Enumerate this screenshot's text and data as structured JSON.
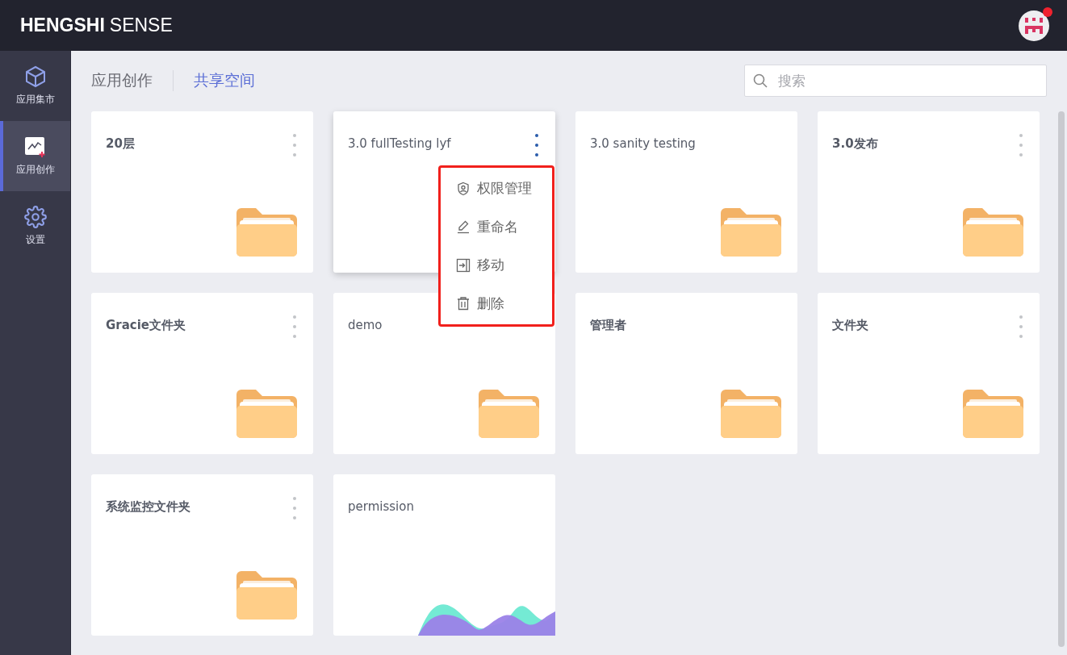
{
  "header": {
    "logo_bold": "HENGSHI",
    "logo_rest": "SENSE",
    "notification": true
  },
  "sidebar": {
    "items": [
      {
        "label": "应用集市",
        "selected": false
      },
      {
        "label": "应用创作",
        "selected": true
      },
      {
        "label": "设置",
        "selected": false
      }
    ]
  },
  "tabs": [
    {
      "label": "应用创作",
      "selected": true
    },
    {
      "label": "共享空间",
      "selected": false
    }
  ],
  "search": {
    "placeholder": "搜索"
  },
  "cards": [
    {
      "title": "20层",
      "kind": "folder",
      "bold": true,
      "menu_button": true,
      "menu_open": false
    },
    {
      "title": "3.0 fullTesting lyf",
      "kind": "folder_hidden",
      "bold": false,
      "menu_button": true,
      "menu_open": true
    },
    {
      "title": "3.0 sanity testing",
      "kind": "folder",
      "bold": false,
      "menu_button": false,
      "menu_open": false
    },
    {
      "title": "3.0发布",
      "kind": "folder",
      "bold": true,
      "menu_button": true,
      "menu_open": false
    },
    {
      "title": "Gracie文件夹",
      "kind": "folder",
      "bold": true,
      "menu_button": true,
      "menu_open": false
    },
    {
      "title": "demo",
      "kind": "folder",
      "bold": false,
      "menu_button": false,
      "menu_open": false
    },
    {
      "title": "管理者",
      "kind": "folder",
      "bold": true,
      "menu_button": false,
      "menu_open": false
    },
    {
      "title": "文件夹",
      "kind": "folder",
      "bold": true,
      "menu_button": true,
      "menu_open": false
    },
    {
      "title": "系统监控文件夹",
      "kind": "folder",
      "bold": true,
      "menu_button": true,
      "menu_open": false
    },
    {
      "title": "permission",
      "kind": "app",
      "bold": false,
      "menu_button": false,
      "menu_open": false
    }
  ],
  "context_menu": {
    "items": [
      {
        "label": "权限管理"
      },
      {
        "label": "重命名"
      },
      {
        "label": "移动"
      },
      {
        "label": "删除"
      }
    ]
  }
}
